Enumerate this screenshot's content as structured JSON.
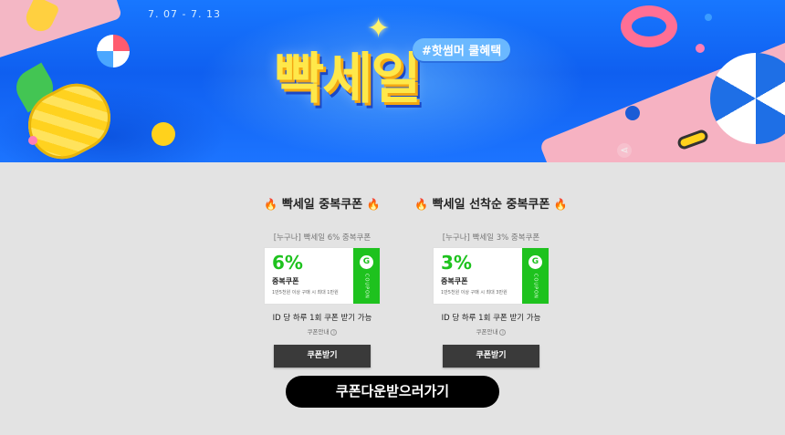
{
  "banner": {
    "date_range": "7. 07 - 7. 13",
    "title": "빡세일",
    "hashtag": "#핫썸머 쿨혜택"
  },
  "coupons": [
    {
      "heading": "빡세일 중복쿠폰",
      "subtitle": "[누구나] 빡세일 6% 중복쿠폰",
      "percent": "6%",
      "coupon_name": "중복쿠폰",
      "coupon_desc": "1만5천원 이상 구매 시 최대 1만원",
      "stub_label": "COUPON",
      "notice": "ID 당 하루 1회 쿠폰 받기 가능",
      "guide_label": "쿠폰안내",
      "button_label": "쿠폰받기"
    },
    {
      "heading": "빡세일 선착순 중복쿠폰",
      "subtitle": "[누구나] 빡세일 3% 중복쿠폰",
      "percent": "3%",
      "coupon_name": "중복쿠폰",
      "coupon_desc": "1만5천원 이상 구매 시 최대 3만원",
      "stub_label": "COUPON",
      "notice": "ID 당 하루 1회 쿠폰 받기 가능",
      "guide_label": "쿠폰안내",
      "button_label": "쿠폰받기"
    }
  ],
  "download_all_label": "쿠폰다운받으러가기",
  "colors": {
    "coupon_green": "#1ec21e",
    "button_dark": "#3a3a3a",
    "cta_black": "#000000",
    "banner_blue": "#1877ff"
  },
  "icons": [
    "fire-icon",
    "g-icon",
    "info-icon",
    "sparkle-icon",
    "share-icon"
  ]
}
